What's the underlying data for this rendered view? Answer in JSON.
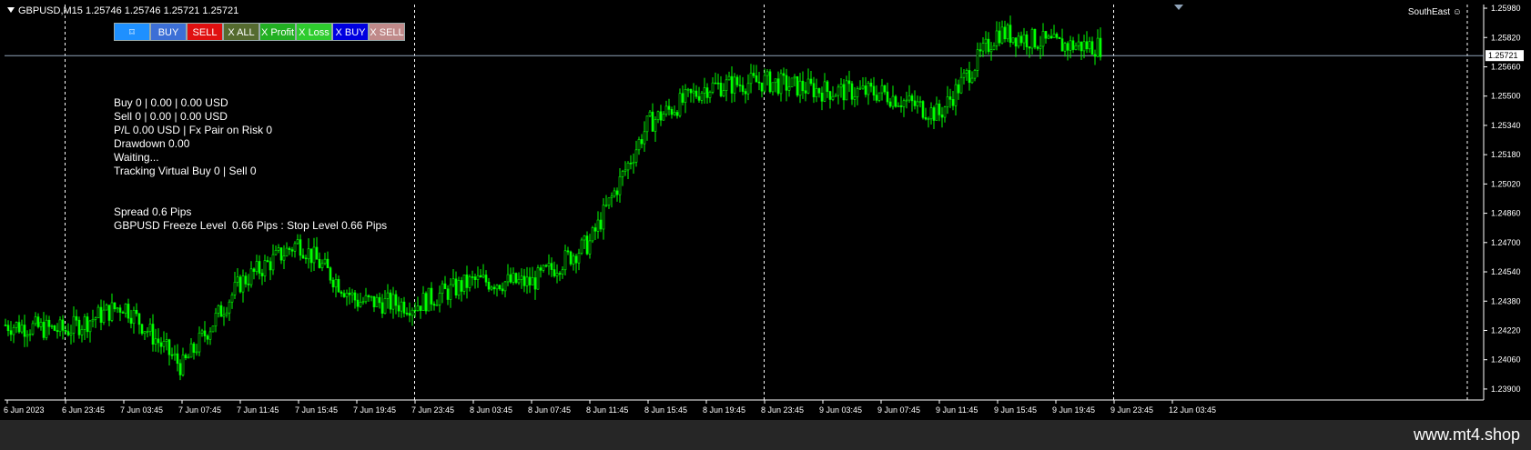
{
  "header": {
    "symbol_info": "GBPUSD,M15  1.25746 1.25746 1.25721 1.25721",
    "corner_label": "SouthEast"
  },
  "toolbar": {
    "buttons": [
      {
        "label": "⌑",
        "color": "#1e90ff"
      },
      {
        "label": "BUY",
        "color": "#3c6fd6"
      },
      {
        "label": "SELL",
        "color": "#e01010"
      },
      {
        "label": "X ALL",
        "color": "#556b2f"
      },
      {
        "label": "X Profit",
        "color": "#22b022"
      },
      {
        "label": "X Loss",
        "color": "#2ecc2e"
      },
      {
        "label": "X BUY",
        "color": "#0000e0"
      },
      {
        "label": "X SELL",
        "color": "#c08a8a"
      }
    ]
  },
  "info_panel": {
    "line1": "Buy 0 | 0.00 | 0.00 USD",
    "line2": "Sell 0 | 0.00 | 0.00 USD",
    "line3": "P/L 0.00 USD | Fx Pair on Risk 0",
    "line4": "Drawdown 0.00",
    "line5": "Waiting...",
    "line6": "Tracking Virtual Buy 0 | Sell 0",
    "line7": "Spread 0.6 Pips",
    "line8": "GBPUSD Freeze Level  0.66 Pips : Stop Level 0.66 Pips"
  },
  "footer": {
    "brand": "www.mt4.shop"
  },
  "colors": {
    "candle": "#00ff00",
    "grid_sep": "#ffffff",
    "axis": "#ffffff",
    "bg": "#000000",
    "current_price_line": "#8fa3b8"
  },
  "chart_data": {
    "type": "candlestick",
    "symbol": "GBPUSD",
    "timeframe": "M15",
    "ylim": [
      1.2384,
      1.26
    ],
    "y_ticks": [
      1.2598,
      1.2582,
      1.2566,
      1.255,
      1.2534,
      1.2518,
      1.2502,
      1.2486,
      1.247,
      1.2454,
      1.2438,
      1.2422,
      1.2406,
      1.239
    ],
    "current_price": 1.25721,
    "x_tick_labels": [
      "6 Jun 2023",
      "6 Jun 23:45",
      "7 Jun 03:45",
      "7 Jun 07:45",
      "7 Jun 11:45",
      "7 Jun 15:45",
      "7 Jun 19:45",
      "7 Jun 23:45",
      "8 Jun 03:45",
      "8 Jun 07:45",
      "8 Jun 11:45",
      "8 Jun 15:45",
      "8 Jun 19:45",
      "8 Jun 23:45",
      "9 Jun 03:45",
      "9 Jun 07:45",
      "9 Jun 11:45",
      "9 Jun 15:45",
      "9 Jun 19:45",
      "9 Jun 23:45",
      "12 Jun 03:45"
    ],
    "day_separators": [
      "6 Jun 23:45",
      "7 Jun 23:45",
      "8 Jun 23:45",
      "9 Jun 23:45"
    ],
    "close_path": [
      {
        "x": "6 Jun 2023",
        "y": 1.2425
      },
      {
        "x": "6 Jun 23:45",
        "y": 1.2422
      },
      {
        "x": "7 Jun 03:45",
        "y": 1.2436
      },
      {
        "x": "7 Jun 07:45",
        "y": 1.2402
      },
      {
        "x": "7 Jun 11:45",
        "y": 1.2448
      },
      {
        "x": "7 Jun 15:45",
        "y": 1.247
      },
      {
        "x": "7 Jun 19:45",
        "y": 1.2438
      },
      {
        "x": "7 Jun 23:45",
        "y": 1.2436
      },
      {
        "x": "8 Jun 03:45",
        "y": 1.2449
      },
      {
        "x": "8 Jun 07:45",
        "y": 1.2448
      },
      {
        "x": "8 Jun 11:45",
        "y": 1.247
      },
      {
        "x": "8 Jun 15:45",
        "y": 1.2535
      },
      {
        "x": "8 Jun 19:45",
        "y": 1.2555
      },
      {
        "x": "8 Jun 23:45",
        "y": 1.2558
      },
      {
        "x": "9 Jun 03:45",
        "y": 1.2553
      },
      {
        "x": "9 Jun 07:45",
        "y": 1.2552
      },
      {
        "x": "9 Jun 11:45",
        "y": 1.254
      },
      {
        "x": "9 Jun 15:45",
        "y": 1.2585
      },
      {
        "x": "9 Jun 19:45",
        "y": 1.2578
      },
      {
        "x": "9 Jun 23:45",
        "y": 1.2577
      },
      {
        "x": "12 Jun 03:45",
        "y": 1.2573
      }
    ]
  }
}
